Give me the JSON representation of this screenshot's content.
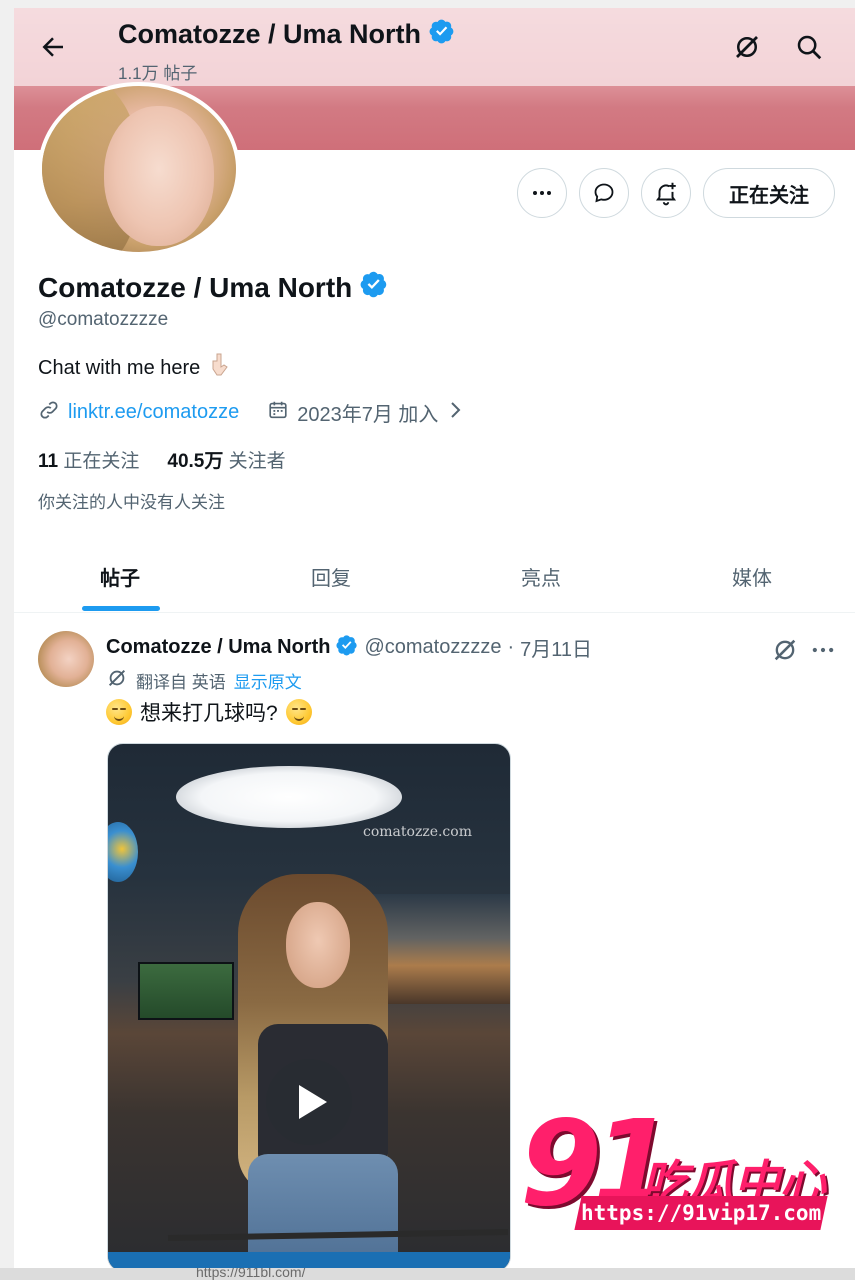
{
  "header": {
    "title": "Comatozze / Uma North",
    "post_count": "1.1万 帖子"
  },
  "profile": {
    "name": "Comatozze / Uma North",
    "handle": "@comatozzzze",
    "bio": "Chat with me here",
    "link": "linktr.ee/comatozze",
    "joined": "2023年7月 加入",
    "following_count": "11",
    "following_label": "正在关注",
    "followers_count": "40.5万",
    "followers_label": "关注者",
    "followers_note": "你关注的人中没有人关注",
    "follow_button_label": "正在关注"
  },
  "tabs": [
    {
      "label": "帖子",
      "active": true
    },
    {
      "label": "回复",
      "active": false
    },
    {
      "label": "亮点",
      "active": false
    },
    {
      "label": "媒体",
      "active": false
    }
  ],
  "post": {
    "author_name": "Comatozze / Uma North",
    "author_handle": "@comatozzzze",
    "separator": "·",
    "date": "7月11日",
    "translated_from": "翻译自 英语",
    "show_original": "显示原文",
    "text": "想来打几球吗?",
    "media_watermark": "comatozze.com"
  },
  "overlay": {
    "logo_number": "91",
    "logo_text": "吃瓜中心",
    "logo_url": "https://91vip17.com"
  },
  "bottom_partial_text": "https://911bl.com/",
  "colors": {
    "accent": "#1d9bf0",
    "verified": "#1d9bf0",
    "text": "#0f1419",
    "secondary_text": "#536471",
    "logo_pink": "#ff1f6b"
  },
  "icons": {
    "back": "arrow-left-icon",
    "grok": "grok-icon",
    "search": "search-icon",
    "more": "more-icon",
    "message": "message-icon",
    "notify": "bell-plus-icon",
    "link": "link-icon",
    "calendar": "calendar-icon",
    "chevron": "chevron-right-icon",
    "translate": "translate-icon",
    "verified": "verified-badge-icon"
  }
}
